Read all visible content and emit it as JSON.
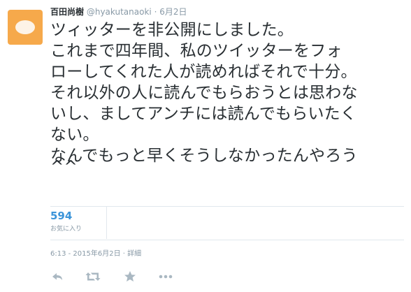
{
  "user": {
    "name": "百田尚樹",
    "handle": "@hyakutanaoki",
    "separator": "·",
    "date": "6月2日"
  },
  "tweet": {
    "lines": [
      "ツィッターを非公開にしました。",
      "これまで四年間、私のツイッターをフォ",
      "ローしてくれた人が読めればそれで十分。",
      "それ以外の人に読んでもらおうとは思わな",
      "いし、ましてアンチには読んでもらいたく",
      "ない。",
      "なんでもっと早くそうしなかったんやろう",
      "^^"
    ]
  },
  "stats": {
    "favorites_count": "594",
    "favorites_label": "お気に入り"
  },
  "timestamp": "6:13 - 2015年6月2日 · 詳細",
  "actions": {
    "icons": [
      "reply-icon",
      "retweet-icon",
      "favorite-icon",
      "more-icon"
    ]
  },
  "colors": {
    "accent": "#3b94d9",
    "muted": "#8899a6",
    "text": "#292f33",
    "divider": "#e1e8ed",
    "avatar": "#f6a94b"
  }
}
